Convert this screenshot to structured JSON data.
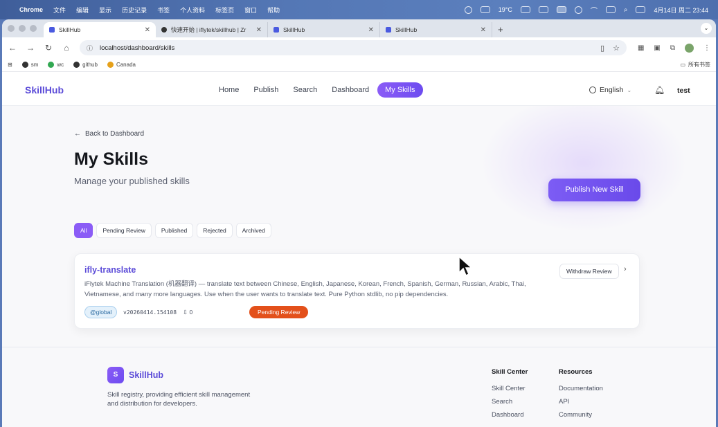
{
  "menubar": {
    "app": "Chrome",
    "items": [
      "文件",
      "编辑",
      "显示",
      "历史记录",
      "书签",
      "个人资料",
      "标签页",
      "窗口",
      "帮助"
    ],
    "weather": "19°C",
    "datetime": "4月14日 周二 23:44"
  },
  "browser": {
    "tabs": [
      {
        "title": "SkillHub",
        "active": true
      },
      {
        "title": "快速开始 | iflytek/skillhub | Zr",
        "active": false
      },
      {
        "title": "SkillHub",
        "active": false
      },
      {
        "title": "SkillHub",
        "active": false
      }
    ],
    "url": "localhost/dashboard/skills",
    "bookmarks": [
      "sm",
      "wc",
      "github",
      "Canada"
    ],
    "all_bookmarks": "所有书签"
  },
  "site": {
    "logo": "SkillHub",
    "nav": [
      "Home",
      "Publish",
      "Search",
      "Dashboard",
      "My Skills"
    ],
    "active_nav": "My Skills",
    "language": "English",
    "user": "test"
  },
  "main": {
    "back": "Back to Dashboard",
    "title": "My Skills",
    "subtitle": "Manage your published skills",
    "publish_button": "Publish New Skill",
    "filters": [
      "All",
      "Pending Review",
      "Published",
      "Rejected",
      "Archived"
    ],
    "active_filter": "All",
    "skill": {
      "name": "ifly-translate",
      "description": "iFlytek Machine Translation (机器翻译) — translate text between Chinese, English, Japanese, Korean, French, Spanish, German, Russian, Arabic, Thai, Vietnamese, and many more languages. Use when the user wants to translate text. Pure Python stdlib, no pip dependencies.",
      "namespace": "@global",
      "version": "v20260414.154108",
      "downloads": "0",
      "status": "Pending Review",
      "withdraw_button": "Withdraw Review"
    }
  },
  "footer": {
    "logo_letter": "S",
    "logo": "SkillHub",
    "tagline": "Skill registry, providing efficient skill management and distribution for developers.",
    "columns": [
      {
        "heading": "Skill Center",
        "links": [
          "Skill Center",
          "Search",
          "Dashboard"
        ]
      },
      {
        "heading": "Resources",
        "links": [
          "Documentation",
          "API",
          "Community"
        ]
      }
    ]
  },
  "colors": {
    "accent": "#8b5cf6",
    "brand": "#5b4bd8",
    "status_pending": "#e3501a"
  }
}
